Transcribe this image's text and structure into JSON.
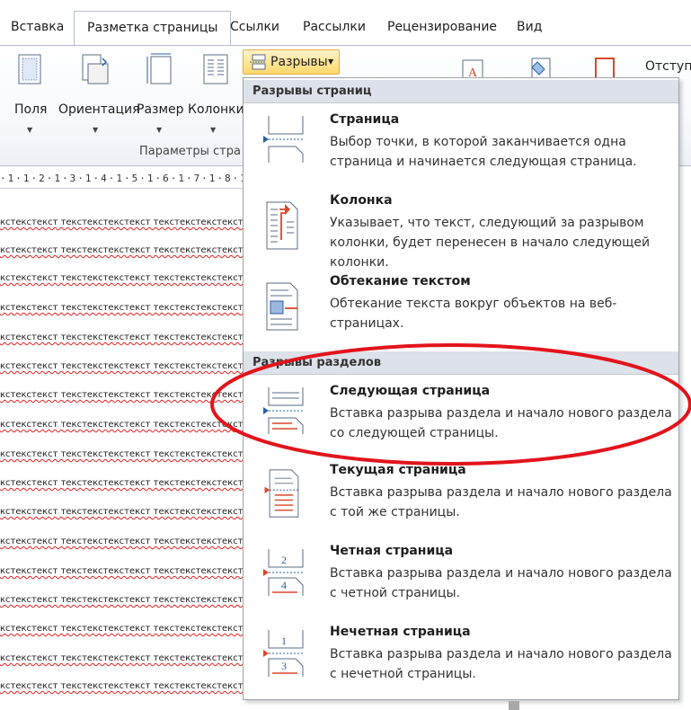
{
  "tabs": {
    "insert": "Вставка",
    "page_layout": "Разметка страницы",
    "references": "Ссылки",
    "mailings": "Рассылки",
    "review": "Рецензирование",
    "view": "Вид"
  },
  "ribbon": {
    "margins": "Поля",
    "orientation": "Ориентация",
    "size": "Размер",
    "columns": "Колонки",
    "breaks": "Разрывы",
    "group_label": "Параметры стра",
    "indent": "Отступ"
  },
  "ruler": "·1·1·2·1·3·1·4·1·5·1·6·1·7·1·8·1·",
  "document": {
    "line_text": "кстекстекст текстекстекстекст текстекстекстекстекстекстекст"
  },
  "menu": {
    "page_breaks_header": "Разрывы страниц",
    "section_breaks_header": "Разрывы разделов",
    "items": [
      {
        "title": "Страница",
        "desc": "Выбор точки, в которой заканчивается одна страница и начинается следующая страница."
      },
      {
        "title": "Колонка",
        "desc": "Указывает, что текст, следующий за разрывом колонки, будет перенесен в начало следующей колонки."
      },
      {
        "title": "Обтекание текстом",
        "desc": "Обтекание текста вокруг объектов на веб-страницах."
      },
      {
        "title": "Следующая страница",
        "desc": "Вставка разрыва раздела и начало нового раздела со следующей страницы."
      },
      {
        "title": "Текущая страница",
        "desc": "Вставка разрыва раздела и начало нового раздела с той же страницы."
      },
      {
        "title": "Четная страница",
        "desc": "Вставка разрыва раздела и начало нового раздела с четной страницы."
      },
      {
        "title": "Нечетная страница",
        "desc": "Вставка разрыва раздела и начало нового раздела с нечетной страницы."
      }
    ]
  },
  "icon_digits": {
    "even": "2",
    "even_next": "4",
    "odd": "1",
    "odd_next": "3"
  },
  "colors": {
    "highlight": "#e2141c",
    "accent_red": "#d9472b",
    "accent_blue": "#2c5fa6"
  }
}
